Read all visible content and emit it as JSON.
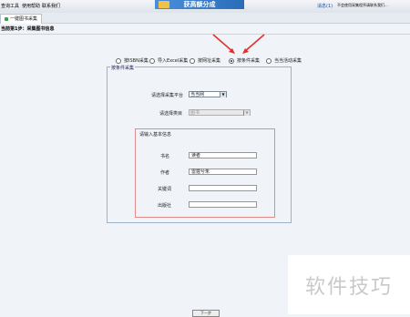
{
  "toolbar": {
    "items": [
      "查询工具",
      "使用帮助",
      "联系我们"
    ],
    "banner_text": "获高额分成",
    "right_link": "消息(1)",
    "right_text": "不会使用采集程序请联系我们..."
  },
  "tab": {
    "label": "一键图书采集"
  },
  "breadcrumb": "当前第1步：采集图书信息",
  "modes": [
    {
      "label": "按ISBN采集",
      "selected": false
    },
    {
      "label": "导入Excel采集",
      "selected": false
    },
    {
      "label": "按网址采集",
      "selected": false
    },
    {
      "label": "按条件采集",
      "selected": true
    },
    {
      "label": "当当活动采集",
      "selected": false
    }
  ],
  "panel": {
    "legend": "按条件采集",
    "platform_label": "请选择采集平台",
    "platform_value": "当当网",
    "category_label": "请选择类目",
    "category_value": "图书",
    "basic_title": "请输入基本信息",
    "fields": [
      {
        "label": "书名",
        "value": "读者"
      },
      {
        "label": "作者",
        "value": "雷霆兮朱"
      },
      {
        "label": "关键词",
        "value": ""
      },
      {
        "label": "出版社",
        "value": ""
      }
    ]
  },
  "next_label": "下一步",
  "watermark": "软件技巧",
  "colors": {
    "arrow": "#e0322a",
    "basic_border": "#e08a8a"
  }
}
